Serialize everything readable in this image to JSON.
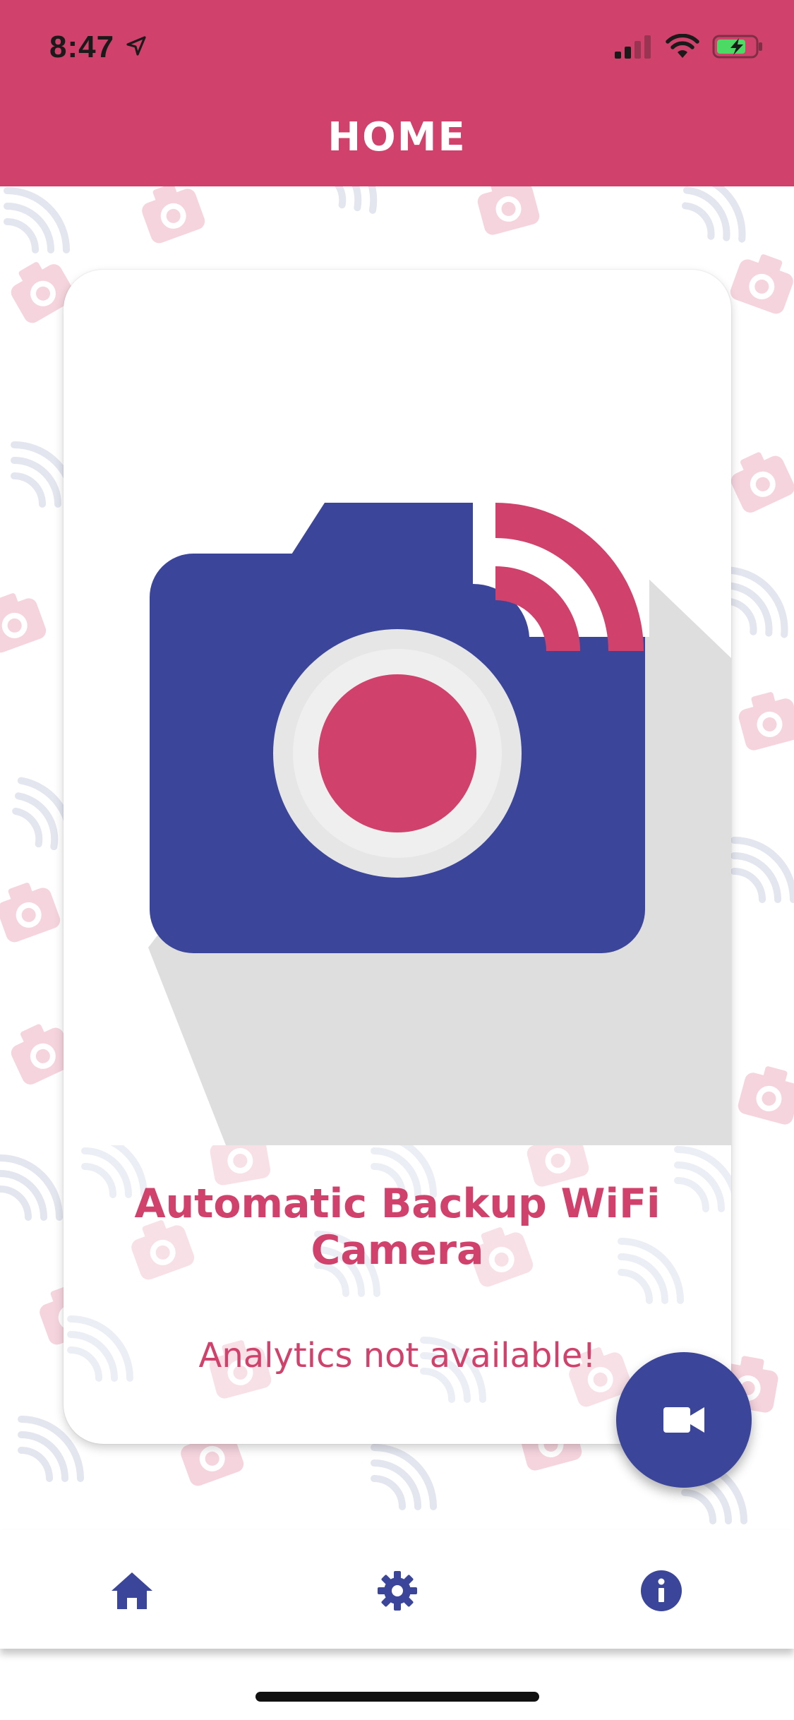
{
  "status_bar": {
    "time": "8:47"
  },
  "header": {
    "title": "HOME"
  },
  "card": {
    "app_title": "Automatic Backup WiFi Camera",
    "analytics_message": "Analytics not available!"
  },
  "fab": {
    "icon": "videocam-icon"
  },
  "bottom_nav": {
    "items": [
      {
        "icon": "home-icon"
      },
      {
        "icon": "settings-icon"
      },
      {
        "icon": "info-icon"
      }
    ]
  },
  "colors": {
    "primary_pink": "#d0416b",
    "primary_blue": "#3b469b",
    "shadow_gray": "#dedede"
  }
}
